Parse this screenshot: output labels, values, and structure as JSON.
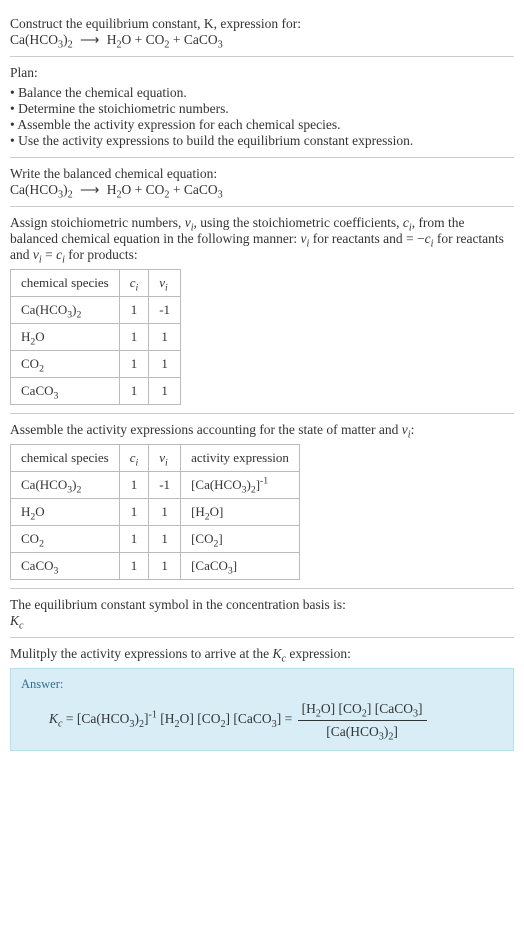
{
  "intro": {
    "construct": "Construct the equilibrium constant, K, expression for:",
    "eqLeft": "Ca(HCO",
    "eqLeft2": ")",
    "arrow": "⟶",
    "h2o": "H",
    "o": "O",
    "plus": " + ",
    "co": "CO",
    "caco": "CaCO"
  },
  "planLabel": "Plan:",
  "plan": [
    "Balance the chemical equation.",
    "Determine the stoichiometric numbers.",
    "Assemble the activity expression for each chemical species.",
    "Use the activity expressions to build the equilibrium constant expression."
  ],
  "writeBal": "Write the balanced chemical equation:",
  "assignText1": "Assign stoichiometric numbers, ",
  "assignText2": ", using the stoichiometric coefficients, ",
  "assignText3": ", from the balanced chemical equation in the following manner: ",
  "assignText4": " for reactants and ",
  "assignText5": " for products:",
  "nu": "ν",
  "ci": "c",
  "eqA": " = −",
  "eqB": " = ",
  "table1": {
    "h1": "chemical species",
    "h2": "c",
    "h3": "ν",
    "rows": [
      {
        "s": "Ca(HCO",
        "sub1": "3",
        "s2": ")",
        "sub2": "2",
        "c": "1",
        "v": "-1"
      },
      {
        "s": "H",
        "sub1": "2",
        "s2": "O",
        "sub2": "",
        "c": "1",
        "v": "1"
      },
      {
        "s": "CO",
        "sub1": "2",
        "s2": "",
        "sub2": "",
        "c": "1",
        "v": "1"
      },
      {
        "s": "CaCO",
        "sub1": "3",
        "s2": "",
        "sub2": "",
        "c": "1",
        "v": "1"
      }
    ]
  },
  "assembleText": "Assemble the activity expressions accounting for the state of matter and ",
  "assembleText2": ":",
  "table2": {
    "h1": "chemical species",
    "h2": "c",
    "h3": "ν",
    "h4": "activity expression",
    "rows": [
      {
        "s": "Ca(HCO",
        "sub1": "3",
        "s2": ")",
        "sub2": "2",
        "c": "1",
        "v": "-1",
        "a": "[Ca(HCO",
        "asub": "3",
        "a2": ")",
        "asub2": "2",
        "a3": "]",
        "exp": "-1"
      },
      {
        "s": "H",
        "sub1": "2",
        "s2": "O",
        "sub2": "",
        "c": "1",
        "v": "1",
        "a": "[H",
        "asub": "2",
        "a2": "O]",
        "asub2": "",
        "a3": "",
        "exp": ""
      },
      {
        "s": "CO",
        "sub1": "2",
        "s2": "",
        "sub2": "",
        "c": "1",
        "v": "1",
        "a": "[CO",
        "asub": "2",
        "a2": "]",
        "asub2": "",
        "a3": "",
        "exp": ""
      },
      {
        "s": "CaCO",
        "sub1": "3",
        "s2": "",
        "sub2": "",
        "c": "1",
        "v": "1",
        "a": "[CaCO",
        "asub": "3",
        "a2": "]",
        "asub2": "",
        "a3": "",
        "exp": ""
      }
    ]
  },
  "eqSymText": "The equilibrium constant symbol in the concentration basis is:",
  "Kc": "K",
  "multiplyText": "Mulitply the activity expressions to arrive at the ",
  "multiplyText2": " expression:",
  "answerLabel": "Answer:",
  "ans": {
    "lhs": "K",
    "eq": " = ",
    "t1": "[Ca(HCO",
    "t2": ")",
    "t3": "]",
    "h2o": "[H",
    "h2o2": "O] ",
    "co2": "[CO",
    "co22": "] ",
    "caco3": "[CaCO",
    "caco32": "] ",
    "eq2": " = "
  },
  "subi": "i",
  "subc": "c",
  "sub2": "2",
  "sub3": "3"
}
